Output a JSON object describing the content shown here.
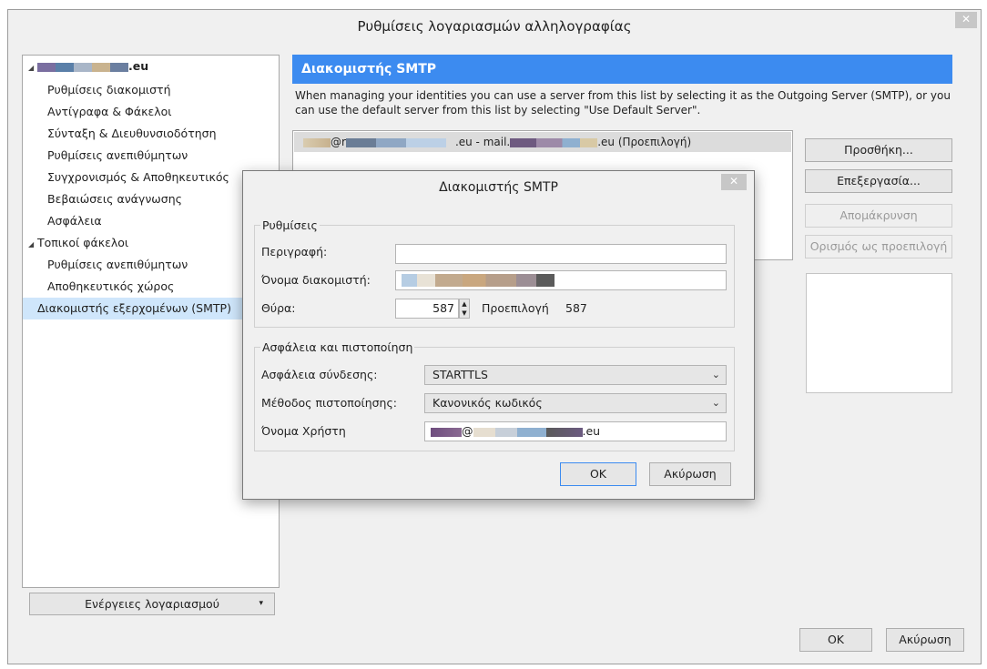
{
  "window": {
    "title": "Ρυθμίσεις λογαριασμών αλληλογραφίας",
    "close_glyph": "✕",
    "ok_label": "OK",
    "cancel_label": "Ακύρωση"
  },
  "sidebar": {
    "account_name_suffix": ".eu",
    "items": [
      {
        "label": "Ρυθμίσεις διακομιστή"
      },
      {
        "label": "Αντίγραφα & Φάκελοι"
      },
      {
        "label": "Σύνταξη & Διευθυνσιοδότηση"
      },
      {
        "label": "Ρυθμίσεις ανεπιθύμητων"
      },
      {
        "label": "Συγχρονισμός & Αποθηκευτικός"
      },
      {
        "label": "Βεβαιώσεις ανάγνωσης"
      },
      {
        "label": "Ασφάλεια"
      }
    ],
    "local_folders": "Τοπικοί φάκελοι",
    "local_items": [
      {
        "label": "Ρυθμίσεις ανεπιθύμητων"
      },
      {
        "label": "Αποθηκευτικός χώρος"
      }
    ],
    "smtp_item": "Διακομιστής εξερχομένων (SMTP)",
    "account_actions": "Ενέργειες λογαριασμού"
  },
  "smtp_page": {
    "header": "Διακομιστής SMTP",
    "description": "When managing your identities you can use a server from this list by selecting it as the Outgoing Server (SMTP), or you can use the default server from this list by selecting \"Use Default Server\".",
    "server_row": {
      "part1": "@r",
      "part2": ".eu - mail.",
      "part3": ".eu (Προεπιλογή)"
    },
    "buttons": {
      "add": "Προσθήκη...",
      "edit": "Επεξεργασία...",
      "remove": "Απομάκρυνση",
      "set_default": "Ορισμός ως προεπιλογή"
    }
  },
  "dialog": {
    "title": "Διακομιστής SMTP",
    "close_glyph": "✕",
    "settings_legend": "Ρυθμίσεις",
    "description_label": "Περιγραφή:",
    "description_value": "",
    "server_name_label": "Όνομα διακομιστή:",
    "port_label": "Θύρα:",
    "port_value": "587",
    "default_label": "Προεπιλογή",
    "default_port": "587",
    "security_legend": "Ασφάλεια και πιστοποίηση",
    "conn_security_label": "Ασφάλεια σύνδεσης:",
    "conn_security_value": "STARTTLS",
    "auth_method_label": "Μέθοδος πιστοποίησης:",
    "auth_method_value": "Κανονικός κωδικός",
    "username_label": "Όνομα Χρήστη",
    "username_mid": "@",
    "username_suffix": ".eu",
    "ok_label": "OK",
    "cancel_label": "Ακύρωση"
  },
  "colors": {
    "header_blue": "#3c8bf0",
    "selected_row": "#cfe6fb"
  }
}
